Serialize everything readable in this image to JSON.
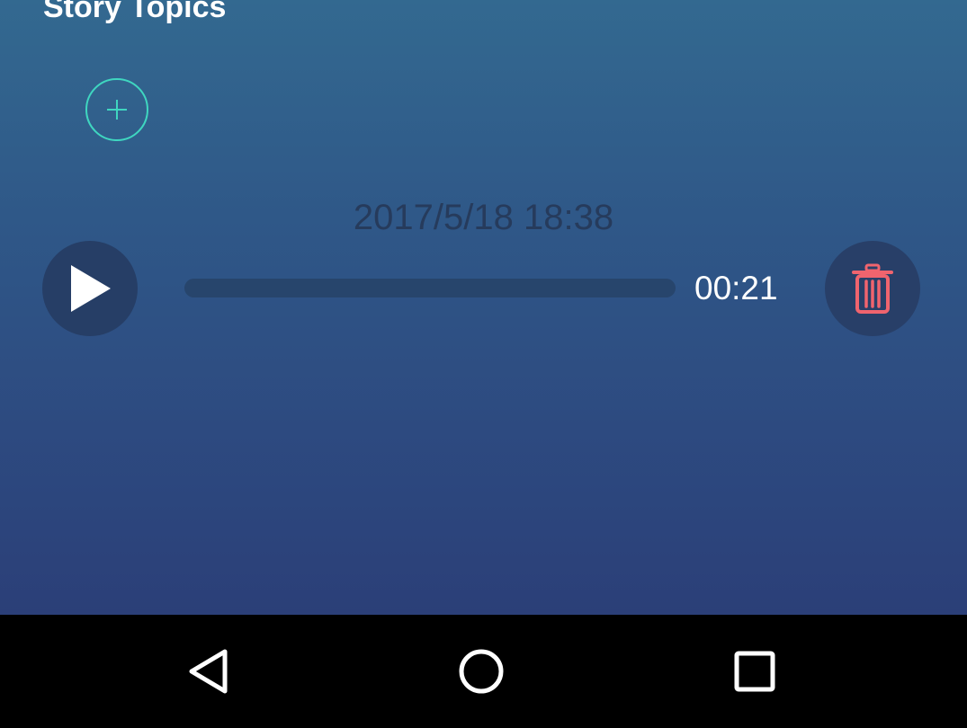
{
  "header": {
    "title": "Story Topics"
  },
  "recording": {
    "date": "2017/5/18 18:38",
    "duration": "00:21",
    "progress": 0
  },
  "icons": {
    "add": "plus-icon",
    "play": "play-icon",
    "delete": "trash-icon",
    "back": "back-triangle-icon",
    "home": "home-circle-icon",
    "recents": "recents-square-icon"
  },
  "colors": {
    "accent": "#3fd6c0",
    "delete": "#f0646e",
    "background_top": "#336990",
    "background_bottom": "#2b3f78"
  }
}
